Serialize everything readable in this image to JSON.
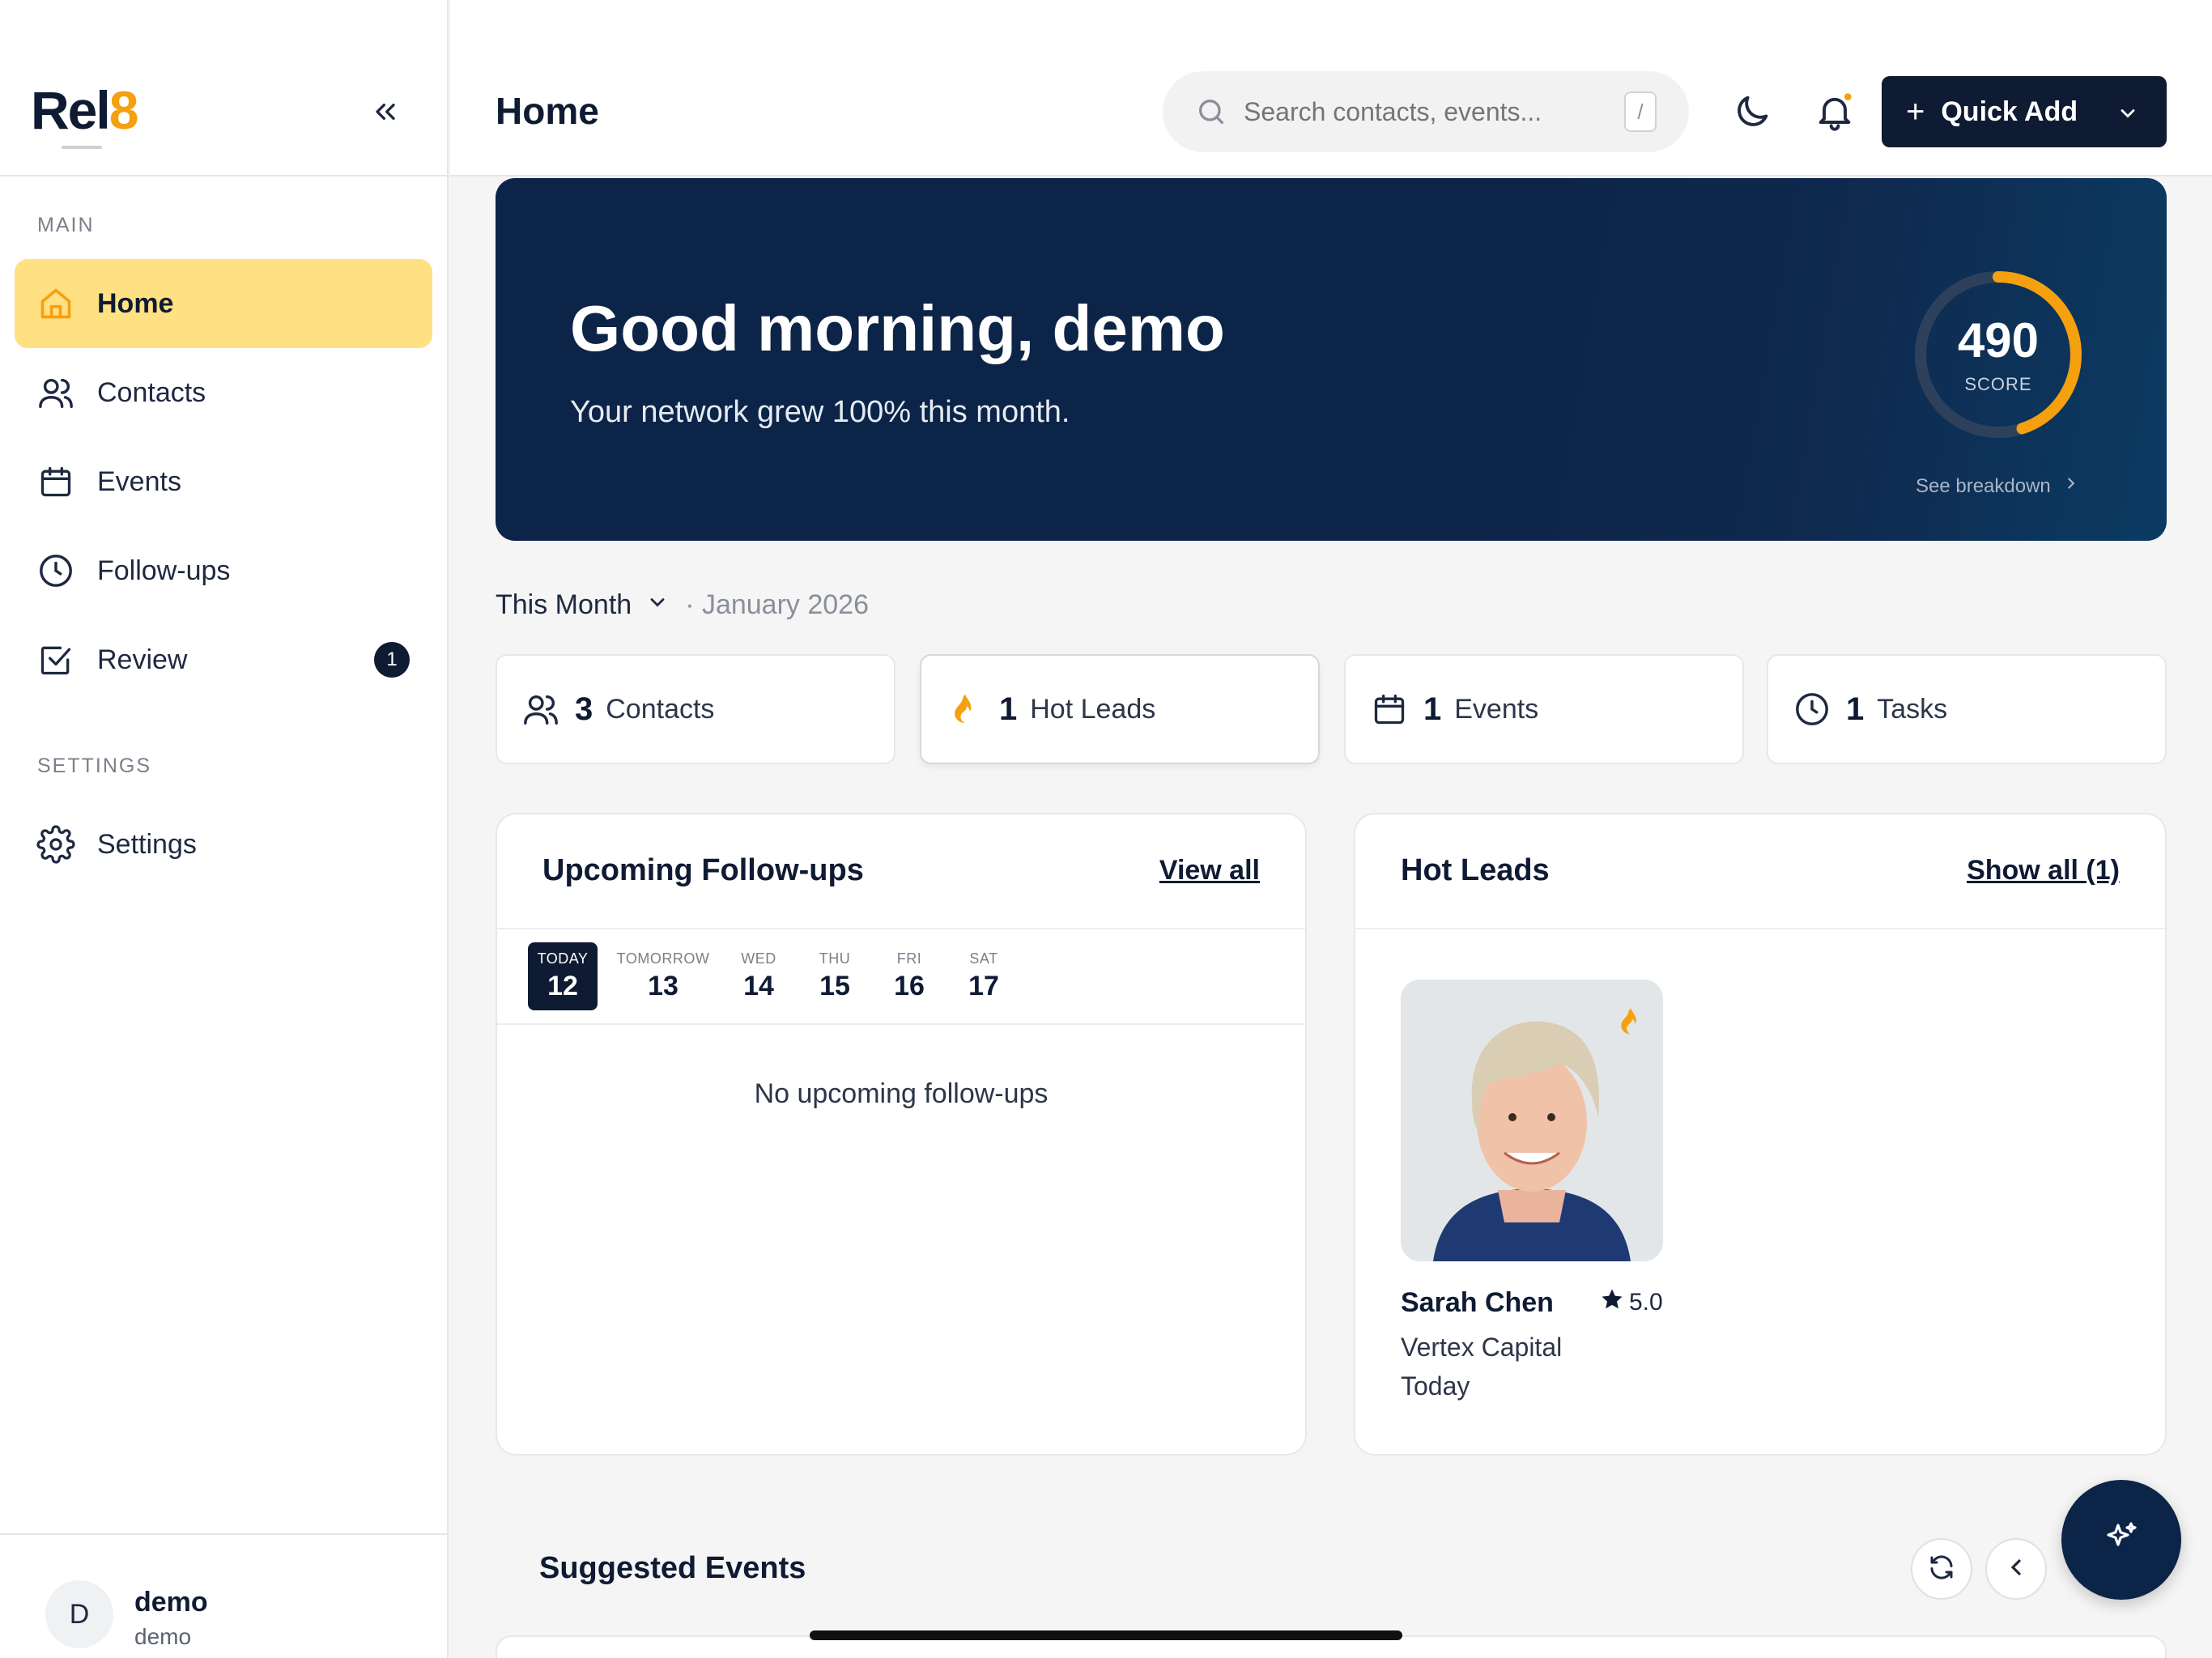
{
  "app": {
    "logo_main": "Rel",
    "logo_accent": "8"
  },
  "sidebar": {
    "main_label": "MAIN",
    "settings_label": "SETTINGS",
    "items": [
      {
        "label": "Home",
        "icon": "home-icon",
        "active": true
      },
      {
        "label": "Contacts",
        "icon": "users-icon"
      },
      {
        "label": "Events",
        "icon": "calendar-icon"
      },
      {
        "label": "Follow-ups",
        "icon": "clock-icon"
      },
      {
        "label": "Review",
        "icon": "check-square-icon",
        "badge": "1"
      }
    ],
    "settings_item": {
      "label": "Settings",
      "icon": "gear-icon"
    },
    "user": {
      "initial": "D",
      "name": "demo",
      "sub": "demo"
    }
  },
  "header": {
    "title": "Home",
    "search_placeholder": "Search contacts, events...",
    "search_shortcut": "/",
    "quick_add": "Quick Add"
  },
  "hero": {
    "greeting": "Good morning, demo",
    "subtitle": "Your network grew 100% this month.",
    "score": "490",
    "score_label": "SCORE",
    "score_progress": 0.45,
    "breakdown": "See breakdown"
  },
  "period": {
    "selected": "This Month",
    "date": "· January 2026"
  },
  "stats": [
    {
      "num": "3",
      "label": "Contacts",
      "icon": "users-icon"
    },
    {
      "num": "1",
      "label": "Hot Leads",
      "icon": "flame-icon"
    },
    {
      "num": "1",
      "label": "Events",
      "icon": "calendar-icon"
    },
    {
      "num": "1",
      "label": "Tasks",
      "icon": "clock-icon"
    }
  ],
  "followups": {
    "title": "Upcoming Follow-ups",
    "link": "View all",
    "days": [
      {
        "name": "TODAY",
        "date": "12"
      },
      {
        "name": "TOMORROW",
        "date": "13"
      },
      {
        "name": "WED",
        "date": "14"
      },
      {
        "name": "THU",
        "date": "15"
      },
      {
        "name": "FRI",
        "date": "16"
      },
      {
        "name": "SAT",
        "date": "17"
      }
    ],
    "empty": "No upcoming follow-ups"
  },
  "hotleads": {
    "title": "Hot Leads",
    "link": "Show all (1)",
    "lead": {
      "name": "Sarah Chen",
      "rating": "5.0",
      "company": "Vertex Capital",
      "when": "Today"
    }
  },
  "suggested": {
    "title": "Suggested Events"
  },
  "colors": {
    "navy": "#0f1b33",
    "accent": "#f5a00f",
    "active_bg": "#ffe082"
  }
}
